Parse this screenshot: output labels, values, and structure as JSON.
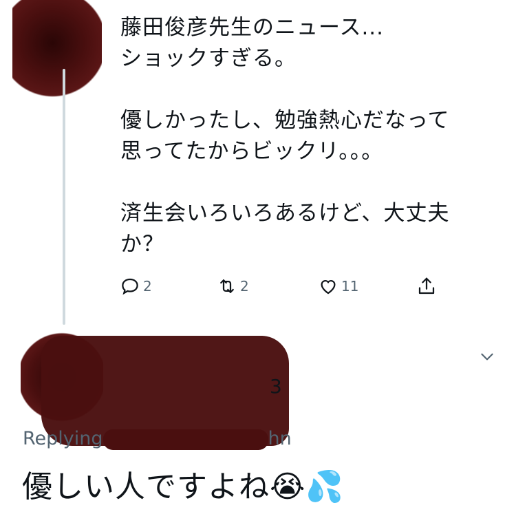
{
  "tweet": {
    "text": "藤田俊彦先生のニュース...\nショックすぎる。\n\n優しかったし、勉強熱心だなって\n思ってたからビックリ。。。\n\n済生会いろいろあるけど、大丈夫\nか？",
    "actions": {
      "reply_count": "2",
      "retweet_count": "2",
      "like_count": "11"
    }
  },
  "reply": {
    "handle_tail": "3",
    "replying_prefix": "Replying",
    "replying_tail": "hn",
    "text": "優しい人ですよね😭💦"
  },
  "icons": [
    "reply-icon",
    "retweet-icon",
    "like-icon",
    "share-icon",
    "chevron-down-icon"
  ],
  "colors": {
    "redaction": "#4a0f0f",
    "action_gray": "#536471",
    "thread_line": "#cfd9de"
  }
}
